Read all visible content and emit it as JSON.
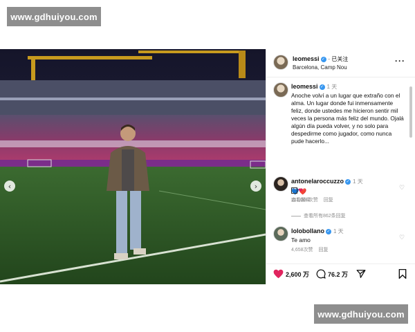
{
  "watermark": {
    "top": "www.gdhuiyou.com",
    "bottom": "www.gdhuiyou.com"
  },
  "post": {
    "username": "leomessi",
    "follow_status": "· 已关注",
    "location": "Barcelona, Camp Nou",
    "more": "···",
    "caption": {
      "username": "leomessi",
      "time": "1 天",
      "text": "Anoche volví a un lugar que extraño con el alma. Un lugar donde fui inmensamente feliz, donde ustedes me hicieron sentir mil veces la persona más feliz del mundo. Ojalá algún día pueda volver, y no solo para despedirme como jugador, como nunca pude hacerlo...",
      "emojis": "💙❤️",
      "translate": "查看翻译"
    },
    "comments": [
      {
        "username": "antonelaroccuzzo",
        "time": "1 天",
        "text": "❤",
        "likes": "211,066次赞",
        "reply": "回复"
      },
      {
        "username": "lolobollano",
        "time": "1 天",
        "text": "Te amo",
        "likes": "4,658次赞",
        "reply": "回复"
      }
    ],
    "view_replies": "查看所有862条回复",
    "actions": {
      "likes": "2,600 万",
      "comments": "76.2 万"
    }
  },
  "colors": {
    "accent_blue": "#3897f0",
    "like_red": "#e0245e"
  },
  "icons": [
    "verified-icon",
    "more-icon",
    "heart-icon",
    "comment-icon",
    "share-icon",
    "bookmark-icon",
    "chevron-left-icon",
    "chevron-right-icon"
  ]
}
